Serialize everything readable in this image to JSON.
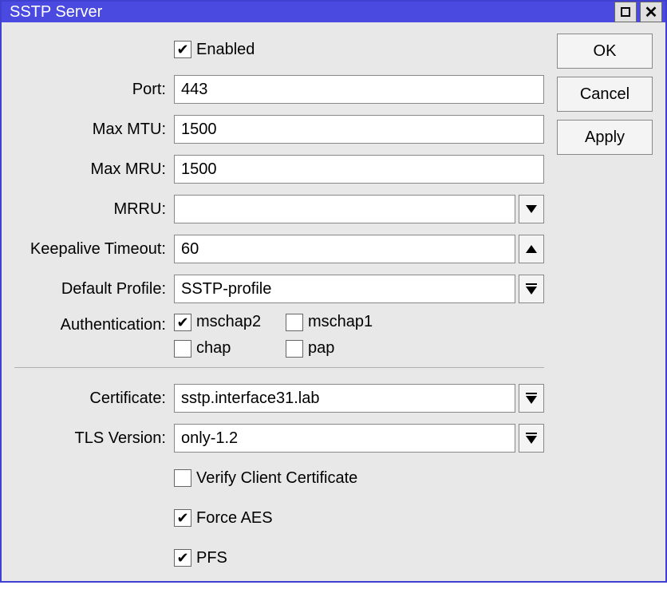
{
  "window": {
    "title": "SSTP Server"
  },
  "buttons": {
    "ok": "OK",
    "cancel": "Cancel",
    "apply": "Apply"
  },
  "labels": {
    "enabled": "Enabled",
    "port": "Port:",
    "max_mtu": "Max MTU:",
    "max_mru": "Max MRU:",
    "mrru": "MRRU:",
    "keepalive": "Keepalive Timeout:",
    "default_profile": "Default Profile:",
    "authentication": "Authentication:",
    "certificate": "Certificate:",
    "tls_version": "TLS Version:",
    "verify_client": "Verify Client Certificate",
    "force_aes": "Force AES",
    "pfs": "PFS",
    "mschap2": "mschap2",
    "mschap1": "mschap1",
    "chap": "chap",
    "pap": "pap"
  },
  "values": {
    "enabled": true,
    "port": "443",
    "max_mtu": "1500",
    "max_mru": "1500",
    "mrru": "",
    "keepalive": "60",
    "default_profile": "SSTP-profile",
    "mschap2": true,
    "mschap1": false,
    "chap": false,
    "pap": false,
    "certificate": "sstp.interface31.lab",
    "tls_version": "only-1.2",
    "verify_client": false,
    "force_aes": true,
    "pfs": true
  }
}
